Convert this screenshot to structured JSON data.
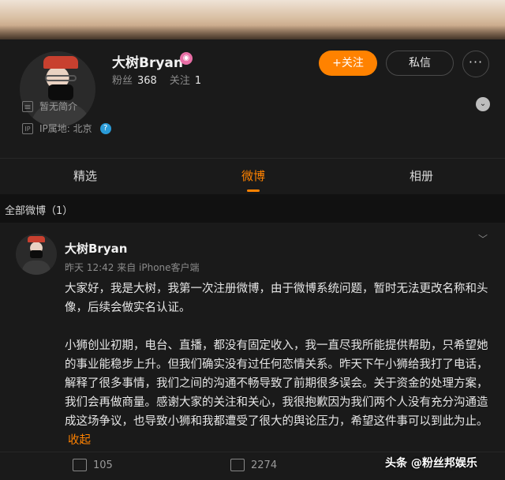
{
  "profile": {
    "name": "大树Bryan",
    "badge_icon": "verified-badge-icon",
    "fans_label": "粉丝",
    "fans_count": "368",
    "following_label": "关注",
    "following_count": "1",
    "follow_button": "+关注",
    "message_button": "私信",
    "more_button": "···",
    "intro_text": "暂无简介",
    "ip_text": "IP属地: 北京"
  },
  "tabs": [
    {
      "label": "精选"
    },
    {
      "label": "微博"
    },
    {
      "label": "相册"
    }
  ],
  "section": {
    "title": "全部微博（1）"
  },
  "post": {
    "author": "大树Bryan",
    "meta": "昨天 12:42 来自 iPhone客户端",
    "paragraph1": "大家好，我是大树，我第一次注册微博，由于微博系统问题，暂时无法更改名称和头像，后续会做实名认证。",
    "paragraph2": "小狮创业初期，电台、直播，都没有固定收入，我一直尽我所能提供帮助，只希望她的事业能稳步上升。但我们确实没有过任何恋情关系。昨天下午小狮给我打了电话，解释了很多事情，我们之间的沟通不畅导致了前期很多误会。关于资金的处理方案，我们会再做商量。感谢大家的关注和关心，我很抱歉因为我们两个人没有充分沟通造成这场争议，也导致小狮和我都遭受了很大的舆论压力，希望这件事可以到此为止。",
    "collapse_label": "收起",
    "repost_count": "105",
    "comment_count": "2274"
  },
  "watermark": "头条 @粉丝邦娱乐",
  "colors": {
    "accent": "#ff8200",
    "background": "#111111",
    "panel": "#1a1a1a"
  }
}
